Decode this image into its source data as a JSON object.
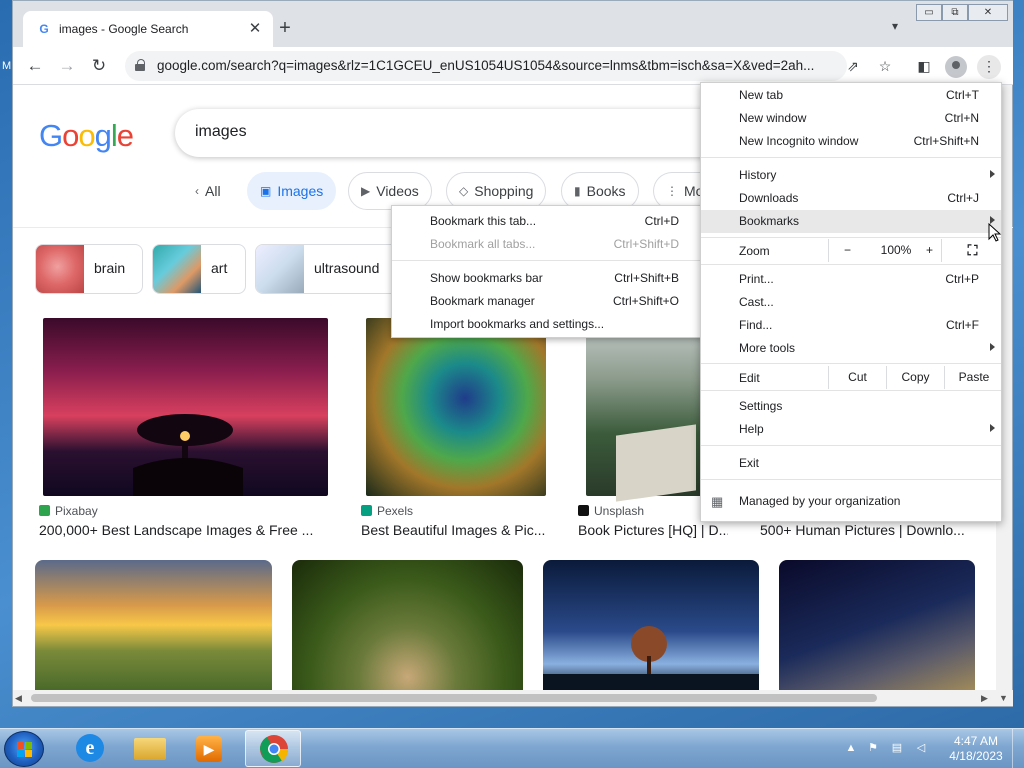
{
  "window": {
    "tab_title": "images - Google Search",
    "tab_favicon_letter": "G",
    "minimize": "▭",
    "maximize": "⧉",
    "close": "✕"
  },
  "toolbar": {
    "url": "google.com/search?q=images&rlz=1C1GCEU_enUS1054US1054&source=lnms&tbm=isch&sa=X&ved=2ah..."
  },
  "google": {
    "logo": [
      "G",
      "o",
      "o",
      "g",
      "l",
      "e"
    ],
    "logo_colors": [
      "#4285f4",
      "#ea4335",
      "#fbbc05",
      "#4285f4",
      "#34a853",
      "#ea4335"
    ],
    "query": "images",
    "chips": [
      {
        "label": "All",
        "icon": "‹"
      },
      {
        "label": "Images",
        "icon": "▣"
      },
      {
        "label": "Videos",
        "icon": "▶"
      },
      {
        "label": "Shopping",
        "icon": "◇"
      },
      {
        "label": "Books",
        "icon": "▮"
      },
      {
        "label": "Mor",
        "icon": "⋮"
      }
    ],
    "related": [
      {
        "label": "brain"
      },
      {
        "label": "art"
      },
      {
        "label": "ultrasound"
      }
    ],
    "results": [
      {
        "source": "Pixabay",
        "title": "200,000+ Best Landscape Images & Free ..."
      },
      {
        "source": "Pexels",
        "title": "Best Beautiful Images & Pic..."
      },
      {
        "source": "Unsplash",
        "title": "Book Pictures [HQ] | D..."
      },
      {
        "source": "",
        "title": "500+ Human Pictures | Downlo..."
      }
    ]
  },
  "bookmarks_menu": {
    "items": [
      {
        "label": "Bookmark this tab...",
        "shortcut": "Ctrl+D"
      },
      {
        "label": "Bookmark all tabs...",
        "shortcut": "Ctrl+Shift+D"
      },
      {
        "label": "Show bookmarks bar",
        "shortcut": "Ctrl+Shift+B"
      },
      {
        "label": "Bookmark manager",
        "shortcut": "Ctrl+Shift+O"
      },
      {
        "label": "Import bookmarks and settings...",
        "shortcut": ""
      }
    ]
  },
  "main_menu": {
    "new_tab": {
      "label": "New tab",
      "shortcut": "Ctrl+T"
    },
    "new_window": {
      "label": "New window",
      "shortcut": "Ctrl+N"
    },
    "new_incognito": {
      "label": "New Incognito window",
      "shortcut": "Ctrl+Shift+N"
    },
    "history": {
      "label": "History"
    },
    "downloads": {
      "label": "Downloads",
      "shortcut": "Ctrl+J"
    },
    "bookmarks": {
      "label": "Bookmarks"
    },
    "zoom": {
      "label": "Zoom",
      "minus": "−",
      "value": "100%",
      "plus": "+",
      "fullscreen": "⛶"
    },
    "print": {
      "label": "Print...",
      "shortcut": "Ctrl+P"
    },
    "cast": {
      "label": "Cast..."
    },
    "find": {
      "label": "Find...",
      "shortcut": "Ctrl+F"
    },
    "more_tools": {
      "label": "More tools"
    },
    "edit": {
      "label": "Edit",
      "cut": "Cut",
      "copy": "Copy",
      "paste": "Paste"
    },
    "settings": {
      "label": "Settings"
    },
    "help": {
      "label": "Help"
    },
    "exit": {
      "label": "Exit"
    },
    "managed": {
      "label": "Managed by your organization"
    }
  },
  "taskbar": {
    "time": "4:47 AM",
    "date": "4/18/2023"
  },
  "desktop": {
    "edge_letter": "M"
  }
}
